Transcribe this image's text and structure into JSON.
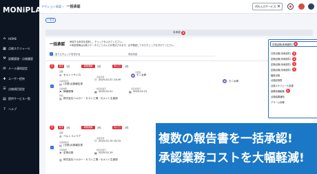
{
  "brand": {
    "logo": "MONiPLAT"
  },
  "sidebar": {
    "items": [
      {
        "label": "HOME",
        "icon": "home-icon"
      },
      {
        "label": "点検スケジュール",
        "icon": "calendar-icon"
      },
      {
        "label": "設備管理・点検履歴",
        "icon": "tool-icon"
      },
      {
        "label": "メール通知設定",
        "icon": "mail-icon"
      },
      {
        "label": "ユーザー招待",
        "icon": "user-plus-icon"
      },
      {
        "label": "点検項目設定",
        "icon": "list-icon"
      },
      {
        "label": "提供サービス一覧",
        "icon": "grid-icon"
      },
      {
        "label": "ヘルプ",
        "icon": "help-icon"
      }
    ]
  },
  "header": {
    "breadcrumb_link": "アクション承認",
    "breadcrumb_sep": "›",
    "breadcrumb_current": "一括承認",
    "user_button": "代行入力サービス",
    "user_button_close": "✕"
  },
  "main": {
    "back_label": "< 戻る",
    "unapproved_label": "未承認",
    "unapproved_count": "2",
    "panel": {
      "title": "一括承認",
      "desc_line1": "承認する申請を選択し、チェックを入れてください。",
      "desc_line2": "※承認現場は点検ステータスごとの入力が表示されます。必ず確認してからチェックを付けてください。",
      "select_all": "全てにチェックを付ける",
      "col_head": "申請内容"
    },
    "records": [
      {
        "alert": "!",
        "tag1": "月次",
        "tag1_value": "1件",
        "tag2": "稼働実績",
        "tag2_value": "2件",
        "tag3": "未入力",
        "tag3_value": "2件",
        "facility_label": "設備",
        "facility": "セメントサイロ",
        "inspect_date_label": "点検日時",
        "inspect_date": "2025.02.21 13:49",
        "inspector_label": "点検者",
        "inspector": "モニ太郎",
        "category_label": "点検項目名",
        "category": "(日常)点検報告書",
        "place_label": "点検場所",
        "place": "稼働現場",
        "last_label": "前回点検日",
        "last": "2025.02.21",
        "next_label": "次回点検日",
        "next": "2025.02.21",
        "company_label": "所属",
        "company": "株式会社ハルカー・セコン工場・セメント生産部",
        "assignee": "モニ太郎"
      },
      {
        "alert": "!",
        "tag1": "月次",
        "tag1_value": "1件",
        "tag2": "稼働実績",
        "tag2_value": "2件",
        "tag3": "未入力",
        "tag3_value": "2件",
        "facility_label": "設備",
        "facility": "ベルトコンベア",
        "inspect_date_label": "点検日時",
        "inspect_date": "2025.02.19 15:23",
        "category_label": "点検項目名",
        "category": "(日常)点検報告書",
        "place_label": "点検場所",
        "place": "定常点検",
        "last_label": "前回点検日",
        "last": "2025.02.19",
        "company": "株式会社ハルカー・セコン工場・セメント生産部"
      }
    ]
  },
  "dropdown": {
    "selected": "日常点検(未承認件)",
    "selected_count": "2",
    "items": [
      {
        "label": "日常点検(未承認件)",
        "count": "2"
      },
      {
        "label": "定期点検(未承認件)",
        "count": "1"
      },
      {
        "label": "定期点検(未承認件)",
        "count": "1"
      },
      {
        "label": "定期点検(未承認件)",
        "count": "1"
      },
      {
        "label": "臨時点検",
        "count": ""
      },
      {
        "label": "点検記録表",
        "count": ""
      },
      {
        "label": "点検スケジュール変更",
        "count": ""
      },
      {
        "label": "設備情報編集",
        "count": "1"
      },
      {
        "label": "点検結果通知",
        "count": ""
      },
      {
        "label": "アラーム情報",
        "count": ""
      }
    ]
  },
  "banner": {
    "line1": "複数の報告書を一括承認!",
    "line2": "承認業務コストを大幅軽減!"
  },
  "colors": {
    "sidebar": "#0d1522",
    "accent": "#2d6bd6",
    "alert": "#e8353e",
    "banner": "#1a78c7"
  }
}
